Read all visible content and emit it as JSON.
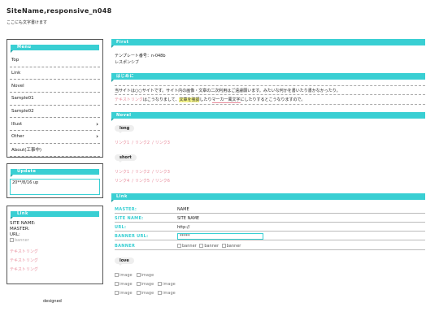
{
  "site": {
    "title": "SiteName,responsive_n048",
    "subtitle": "ここにも文字書けます"
  },
  "sidebar": {
    "menu_title": "Menu",
    "menu_items": [
      {
        "label": "Top",
        "arrow": false
      },
      {
        "label": "Link",
        "arrow": false
      },
      {
        "label": "Novel",
        "arrow": false
      },
      {
        "label": "Sample01",
        "arrow": false
      },
      {
        "label": "Sample02",
        "arrow": false
      },
      {
        "label": "Illust",
        "arrow": true
      },
      {
        "label": "Other",
        "arrow": true
      },
      {
        "label": "About(工事中)",
        "arrow": false
      }
    ],
    "update_title": "Update",
    "update_value": "20**/8/16 up",
    "link_title": "Link",
    "link_fields": [
      "SITE NAME:",
      "MASTER:",
      "URL:"
    ],
    "banner_alt": "banner",
    "text_strings": [
      "テキストリング",
      "テキストリング",
      "テキストリング"
    ],
    "designed": "designed"
  },
  "main": {
    "first": {
      "title": "First",
      "line1": "テンプレート番号：n-048b",
      "line2": "レスポンシブ"
    },
    "hajimeni": {
      "title": "はじめに",
      "line1": "当サイトは○○サイトです。サイト内の画像・文章の二次利用はご遠慮願います。みたいな何かを書いたり書かなかったり。",
      "line2_link": "テキストリンク",
      "line2_a": "はこうなりまして、",
      "line2_hl": "文章を強調",
      "line2_b": "したり",
      "line2_mk": "マーカー風文字",
      "line2_c": "にしたりするとこうなりますので。"
    },
    "novel": {
      "title": "Novel",
      "long_label": "long",
      "long_links": [
        "リンク1",
        "リンク2",
        "リンク3"
      ],
      "short_label": "short",
      "short_links_row1": [
        "リンク1",
        "リンク2",
        "リンク3"
      ],
      "short_links_row2": [
        "リンク4",
        "リンク5",
        "リンク6"
      ]
    },
    "link": {
      "title": "Link",
      "rows": [
        {
          "key": "MASTER:",
          "value": "NAME"
        },
        {
          "key": "SITE NAME:",
          "value": "SITE NAME"
        },
        {
          "key": "URL:",
          "value": "http://"
        },
        {
          "key": "BANNER URL:",
          "value": "*****"
        },
        {
          "key": "BANNER",
          "value": "banner"
        }
      ],
      "love_label": "love",
      "image_alt": "image"
    }
  },
  "colors": {
    "accent": "#39cfd3",
    "link": "#e88a9a",
    "highlight": "#f4f48a"
  }
}
